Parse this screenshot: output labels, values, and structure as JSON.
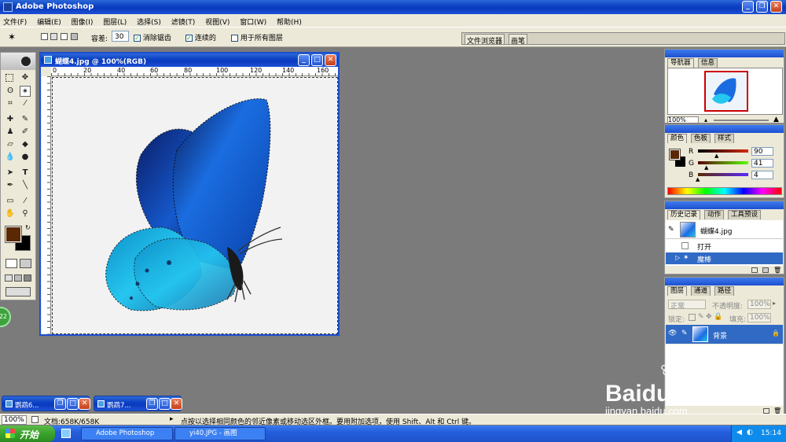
{
  "app": {
    "title": "Adobe Photoshop"
  },
  "menu": [
    "文件(F)",
    "编辑(E)",
    "图像(I)",
    "图层(L)",
    "选择(S)",
    "滤镜(T)",
    "视图(V)",
    "窗口(W)",
    "帮助(H)"
  ],
  "options": {
    "tolerance_label": "容差:",
    "tolerance_value": "30",
    "antialias_label": "消除锯齿",
    "contiguous_label": "连续的",
    "all_layers_label": "用于所有图层",
    "tab_file_browser": "文件浏览器",
    "tab_brushes": "画笔"
  },
  "document": {
    "title": "蝴蝶4.jpg @ 100%(RGB)",
    "ruler_ticks": [
      "0",
      "20",
      "40",
      "60",
      "80",
      "100",
      "120",
      "140",
      "160"
    ]
  },
  "navigator": {
    "tabs": [
      "导航器",
      "信息"
    ],
    "zoom": "100%"
  },
  "color": {
    "tabs": [
      "颜色",
      "色板",
      "样式"
    ],
    "channels": [
      {
        "label": "R",
        "value": "90",
        "fill": 0.35
      },
      {
        "label": "G",
        "value": "41",
        "fill": 0.16
      },
      {
        "label": "B",
        "value": "4",
        "fill": 0.02
      }
    ],
    "foreground": "#5a2904"
  },
  "history": {
    "tabs": [
      "历史记录",
      "动作",
      "工具预设"
    ],
    "snapshot": "蝴蝶4.jpg",
    "items": [
      "打开",
      "魔棒"
    ]
  },
  "layers": {
    "tabs": [
      "图层",
      "通道",
      "路径"
    ],
    "blend_mode": "正常",
    "opacity_label": "不透明度:",
    "opacity_value": "100%",
    "lock_label": "锁定:",
    "fill_label": "填充:",
    "fill_value": "100%",
    "layer_name": "背景"
  },
  "minimized": [
    "鹦鹉6...",
    "鹦鹉7..."
  ],
  "side_badge": "22",
  "status": {
    "zoom": "100%",
    "doc_size": "文档:658K/658K",
    "hint": "点按以选择相同颜色的邻近像素或移动选区外框。要用附加选项，使用 Shift、Alt 和 Ctrl 键。"
  },
  "taskbar": {
    "start": "开始",
    "items": [
      "Adobe Photoshop",
      "yi40.JPG - 画图"
    ],
    "time": "15:14"
  },
  "watermark": {
    "text": "Baidu经验",
    "url": "jingyan.baidu.com"
  }
}
